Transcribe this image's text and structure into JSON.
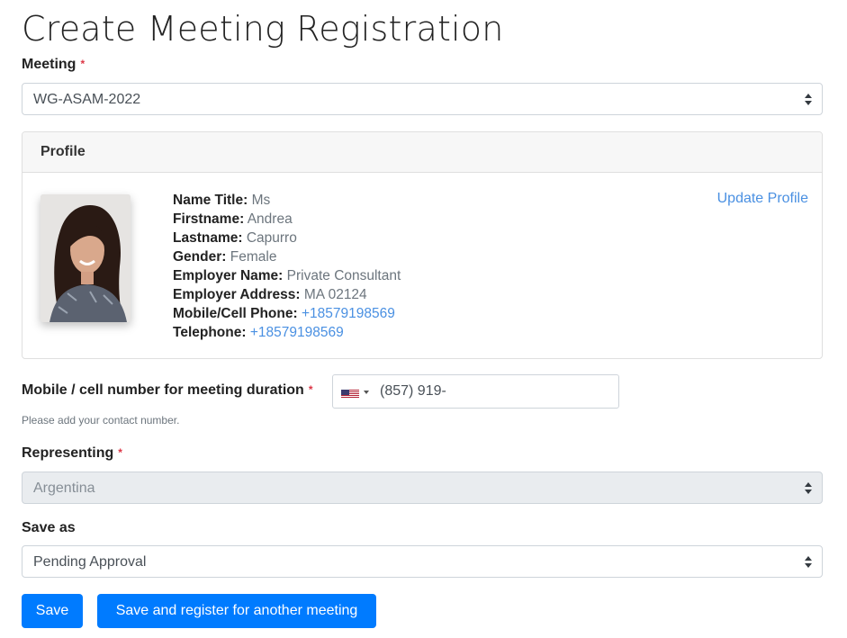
{
  "page": {
    "title": "Create Meeting Registration"
  },
  "meeting": {
    "label": "Meeting",
    "required_mark": "*",
    "selected": "WG-ASAM-2022"
  },
  "profile": {
    "header": "Profile",
    "update_link": "Update Profile",
    "fields": [
      {
        "label": "Name Title:",
        "value": "Ms",
        "is_link": false
      },
      {
        "label": "Firstname:",
        "value": "Andrea",
        "is_link": false
      },
      {
        "label": "Lastname:",
        "value": "Capurro",
        "is_link": false
      },
      {
        "label": "Gender:",
        "value": "Female",
        "is_link": false
      },
      {
        "label": "Employer Name:",
        "value": "Private Consultant",
        "is_link": false
      },
      {
        "label": "Employer Address:",
        "value": "MA 02124",
        "is_link": false
      },
      {
        "label": "Mobile/Cell Phone:",
        "value": "+18579198569",
        "is_link": true
      },
      {
        "label": "Telephone:",
        "value": "+18579198569",
        "is_link": true
      }
    ]
  },
  "mobile": {
    "label": "Mobile / cell number for meeting duration",
    "required_mark": "*",
    "country_icon": "us-flag-icon",
    "value": "(857) 919-",
    "help": "Please add your contact number."
  },
  "representing": {
    "label": "Representing",
    "required_mark": "*",
    "selected": "Argentina"
  },
  "save_as": {
    "label": "Save as",
    "selected": "Pending Approval"
  },
  "buttons": {
    "save": "Save",
    "save_register": "Save and register for another meeting"
  },
  "colors": {
    "primary": "#007bff",
    "link": "#4a90e2",
    "required": "#dc3545"
  }
}
